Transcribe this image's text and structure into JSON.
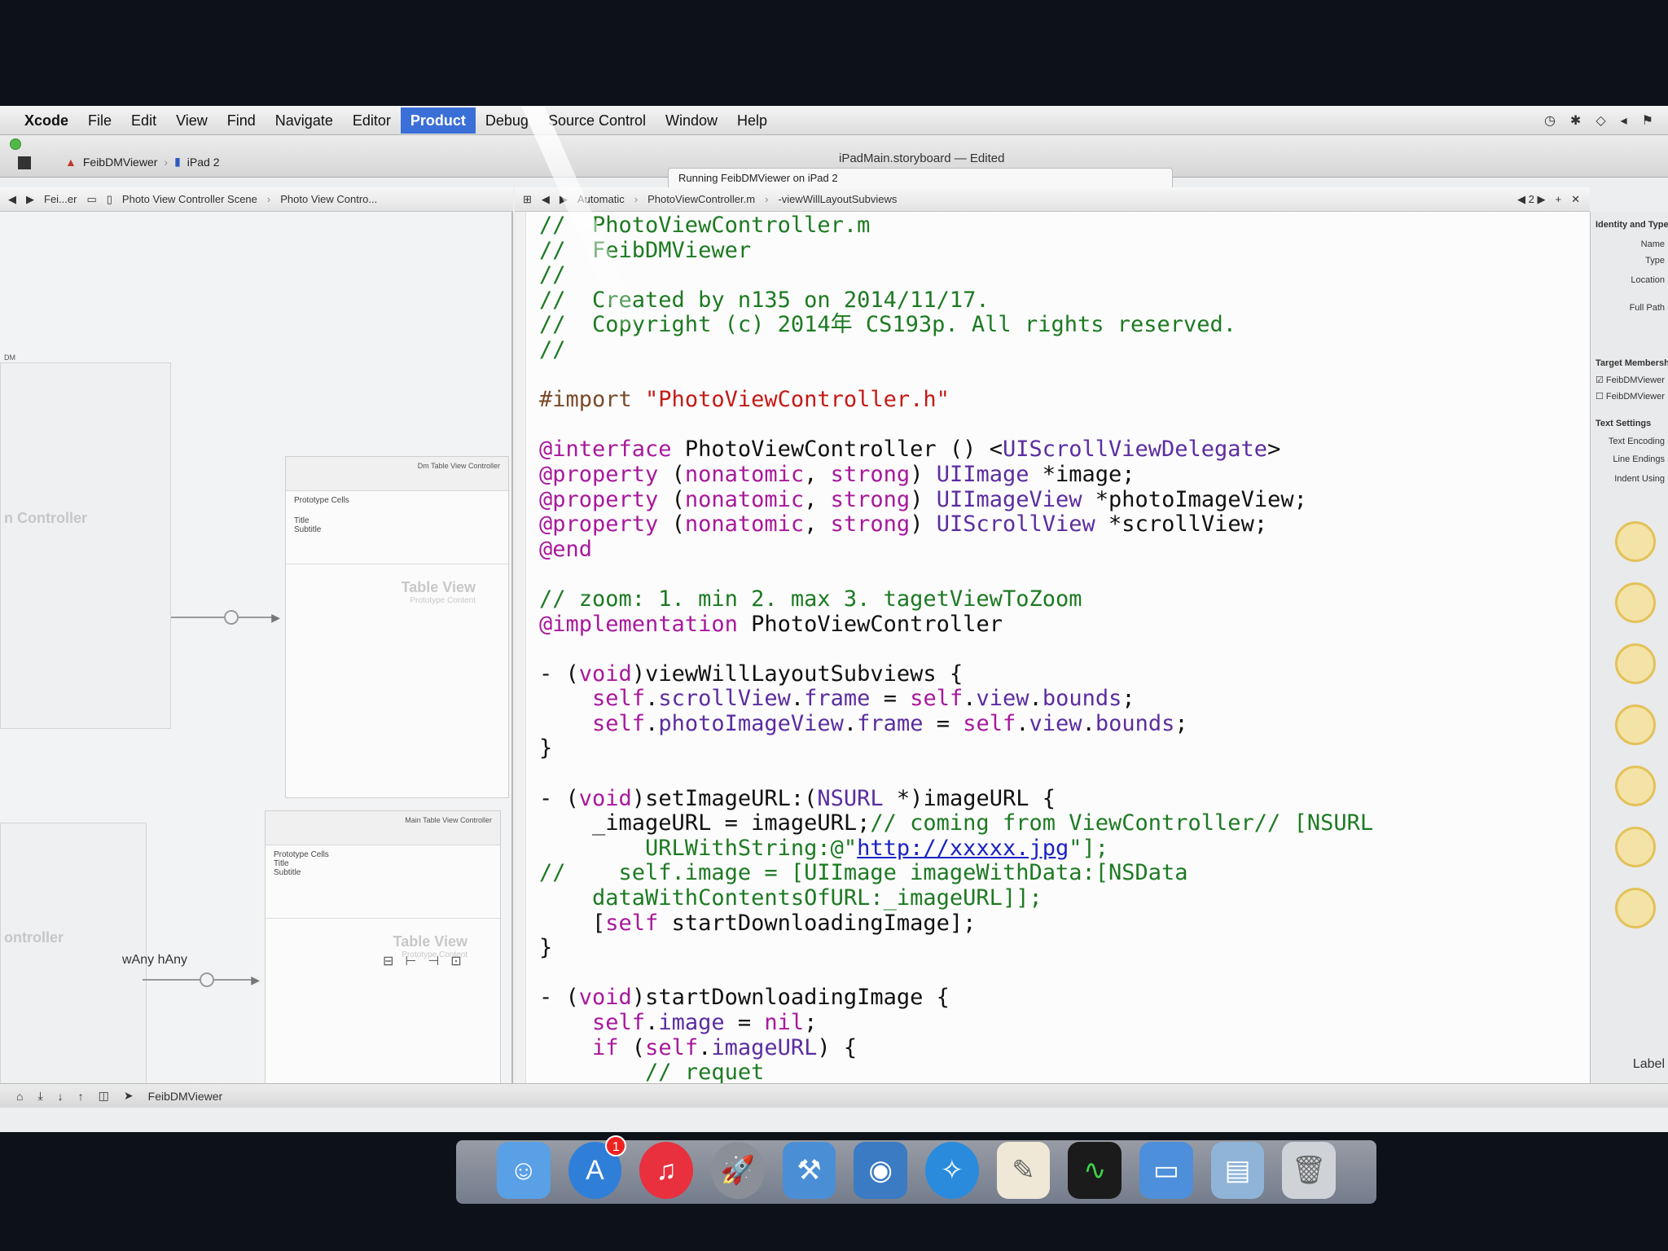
{
  "menubar": {
    "items": [
      "Xcode",
      "File",
      "Edit",
      "View",
      "Find",
      "Navigate",
      "Editor",
      "Product",
      "Debug",
      "Source Control",
      "Window",
      "Help"
    ],
    "active": "Product"
  },
  "toolbar": {
    "scheme": "FeibDMViewer",
    "device": "iPad 2",
    "window_title": "iPadMain.storyboard — Edited",
    "activity": "Running FeibDMViewer on iPad 2"
  },
  "left_jumpbar": [
    "Fei...er",
    "Photo View Controller Scene",
    "Photo View Contro..."
  ],
  "right_jumpbar": [
    "Automatic",
    "PhotoViewController.m",
    "-viewWillLayoutSubviews"
  ],
  "right_jumpbar_counter": "2",
  "storyboard": {
    "top_header": "Dm Table View Controller",
    "bottom_header": "Main Table View Controller",
    "prototype_cells": "Prototype Cells",
    "cell_title": "Title",
    "cell_subtitle": "Subtitle",
    "table_view": "Table View",
    "prototype_content": "Prototype Content",
    "left_label_top": "n Controller",
    "left_label_bottom": "ontroller",
    "dm_label": "DM",
    "size_class": "wAny hAny"
  },
  "code_lines": [
    [
      {
        "t": "//  PhotoViewController.m",
        "c": "com"
      }
    ],
    [
      {
        "t": "//  FeibDMViewer",
        "c": "com"
      }
    ],
    [
      {
        "t": "//",
        "c": "com"
      }
    ],
    [
      {
        "t": "//  Created by n135 on 2014/11/17.",
        "c": "com"
      }
    ],
    [
      {
        "t": "//  Copyright (c) 2014年 CS193p. All rights reserved.",
        "c": "com"
      }
    ],
    [
      {
        "t": "//",
        "c": "com"
      }
    ],
    [
      {
        "t": "",
        "c": ""
      }
    ],
    [
      {
        "t": "#import ",
        "c": "pre"
      },
      {
        "t": "\"PhotoViewController.h\"",
        "c": "str"
      }
    ],
    [
      {
        "t": "",
        "c": ""
      }
    ],
    [
      {
        "t": "@interface",
        "c": "kw"
      },
      {
        "t": " PhotoViewController () <",
        "c": ""
      },
      {
        "t": "UIScrollViewDelegate",
        "c": "typ"
      },
      {
        "t": ">",
        "c": ""
      }
    ],
    [
      {
        "t": "@property",
        "c": "kw"
      },
      {
        "t": " (",
        "c": ""
      },
      {
        "t": "nonatomic",
        "c": "kw"
      },
      {
        "t": ", ",
        "c": ""
      },
      {
        "t": "strong",
        "c": "kw"
      },
      {
        "t": ") ",
        "c": ""
      },
      {
        "t": "UIImage",
        "c": "typ"
      },
      {
        "t": " *image;",
        "c": ""
      }
    ],
    [
      {
        "t": "@property",
        "c": "kw"
      },
      {
        "t": " (",
        "c": ""
      },
      {
        "t": "nonatomic",
        "c": "kw"
      },
      {
        "t": ", ",
        "c": ""
      },
      {
        "t": "strong",
        "c": "kw"
      },
      {
        "t": ") ",
        "c": ""
      },
      {
        "t": "UIImageView",
        "c": "typ"
      },
      {
        "t": " *photoImageView;",
        "c": ""
      }
    ],
    [
      {
        "t": "@property",
        "c": "kw"
      },
      {
        "t": " (",
        "c": ""
      },
      {
        "t": "nonatomic",
        "c": "kw"
      },
      {
        "t": ", ",
        "c": ""
      },
      {
        "t": "strong",
        "c": "kw"
      },
      {
        "t": ") ",
        "c": ""
      },
      {
        "t": "UIScrollView",
        "c": "typ"
      },
      {
        "t": " *scrollView;",
        "c": ""
      }
    ],
    [
      {
        "t": "@end",
        "c": "kw"
      }
    ],
    [
      {
        "t": "",
        "c": ""
      }
    ],
    [
      {
        "t": "// zoom: 1. min 2. max 3. tagetViewToZoom",
        "c": "com"
      }
    ],
    [
      {
        "t": "@implementation",
        "c": "kw"
      },
      {
        "t": " PhotoViewController",
        "c": ""
      }
    ],
    [
      {
        "t": "",
        "c": ""
      }
    ],
    [
      {
        "t": "- (",
        "c": ""
      },
      {
        "t": "void",
        "c": "kw"
      },
      {
        "t": ")viewWillLayoutSubviews {",
        "c": ""
      }
    ],
    [
      {
        "t": "    ",
        "c": ""
      },
      {
        "t": "self",
        "c": "kw"
      },
      {
        "t": ".",
        "c": ""
      },
      {
        "t": "scrollView",
        "c": "typ"
      },
      {
        "t": ".",
        "c": ""
      },
      {
        "t": "frame",
        "c": "typ"
      },
      {
        "t": " = ",
        "c": ""
      },
      {
        "t": "self",
        "c": "kw"
      },
      {
        "t": ".",
        "c": ""
      },
      {
        "t": "view",
        "c": "typ"
      },
      {
        "t": ".",
        "c": ""
      },
      {
        "t": "bounds",
        "c": "typ"
      },
      {
        "t": ";",
        "c": ""
      }
    ],
    [
      {
        "t": "    ",
        "c": ""
      },
      {
        "t": "self",
        "c": "kw"
      },
      {
        "t": ".",
        "c": ""
      },
      {
        "t": "photoImageView",
        "c": "typ"
      },
      {
        "t": ".",
        "c": ""
      },
      {
        "t": "frame",
        "c": "typ"
      },
      {
        "t": " = ",
        "c": ""
      },
      {
        "t": "self",
        "c": "kw"
      },
      {
        "t": ".",
        "c": ""
      },
      {
        "t": "view",
        "c": "typ"
      },
      {
        "t": ".",
        "c": ""
      },
      {
        "t": "bounds",
        "c": "typ"
      },
      {
        "t": ";",
        "c": ""
      }
    ],
    [
      {
        "t": "}",
        "c": ""
      }
    ],
    [
      {
        "t": "",
        "c": ""
      }
    ],
    [
      {
        "t": "- (",
        "c": ""
      },
      {
        "t": "void",
        "c": "kw"
      },
      {
        "t": ")setImageURL:(",
        "c": ""
      },
      {
        "t": "NSURL",
        "c": "typ"
      },
      {
        "t": " *)imageURL {",
        "c": ""
      }
    ],
    [
      {
        "t": "    _imageURL = imageURL;",
        "c": ""
      },
      {
        "t": "// coming from ViewController// [NSURL",
        "c": "com"
      }
    ],
    [
      {
        "t": "        URLWithString:@\"",
        "c": "com"
      },
      {
        "t": "http://xxxxx.jpg",
        "c": "url"
      },
      {
        "t": "\"];",
        "c": "com"
      }
    ],
    [
      {
        "t": "//    self.image = [UIImage imageWithData:[NSData",
        "c": "com"
      }
    ],
    [
      {
        "t": "    dataWithContentsOfURL:_imageURL]];",
        "c": "com"
      }
    ],
    [
      {
        "t": "    [",
        "c": ""
      },
      {
        "t": "self",
        "c": "kw"
      },
      {
        "t": " startDownloadingImage];",
        "c": ""
      }
    ],
    [
      {
        "t": "}",
        "c": ""
      }
    ],
    [
      {
        "t": "",
        "c": ""
      }
    ],
    [
      {
        "t": "- (",
        "c": ""
      },
      {
        "t": "void",
        "c": "kw"
      },
      {
        "t": ")startDownloadingImage {",
        "c": ""
      }
    ],
    [
      {
        "t": "    ",
        "c": ""
      },
      {
        "t": "self",
        "c": "kw"
      },
      {
        "t": ".",
        "c": ""
      },
      {
        "t": "image",
        "c": "typ"
      },
      {
        "t": " = ",
        "c": ""
      },
      {
        "t": "nil",
        "c": "kw"
      },
      {
        "t": ";",
        "c": ""
      }
    ],
    [
      {
        "t": "    ",
        "c": ""
      },
      {
        "t": "if",
        "c": "kw"
      },
      {
        "t": " (",
        "c": ""
      },
      {
        "t": "self",
        "c": "kw"
      },
      {
        "t": ".",
        "c": ""
      },
      {
        "t": "imageURL",
        "c": "typ"
      },
      {
        "t": ") {",
        "c": ""
      }
    ],
    [
      {
        "t": "        // requet",
        "c": "com"
      }
    ]
  ],
  "inspector": {
    "identity_section": "Identity and Type",
    "name_label": "Name",
    "type_label": "Type",
    "location_label": "Location",
    "full_path_label": "Full Path",
    "target_section": "Target Membership",
    "target1": "FeibDMViewer",
    "target2": "FeibDMViewer",
    "text_settings_section": "Text Settings",
    "text_encoding_label": "Text Encoding",
    "line_endings_label": "Line Endings",
    "indent_label": "Indent Using",
    "label_bottom": "Label"
  },
  "bottombar": {
    "target": "FeibDMViewer"
  },
  "dock": {
    "icons": [
      "finder-icon",
      "app-store-icon",
      "itunes-icon",
      "launchpad-icon",
      "xcode-icon",
      "preview-icon",
      "safari-icon",
      "textedit-icon",
      "activity-monitor-icon",
      "folder-icon",
      "downloads-icon",
      "trash-icon"
    ],
    "app_store_badge": "1"
  },
  "colors": {
    "comment": "#1d7a22",
    "keyword": "#a8189c",
    "type": "#5b2da0",
    "string": "#c41a16",
    "menu_active": "#3b6fd8"
  }
}
